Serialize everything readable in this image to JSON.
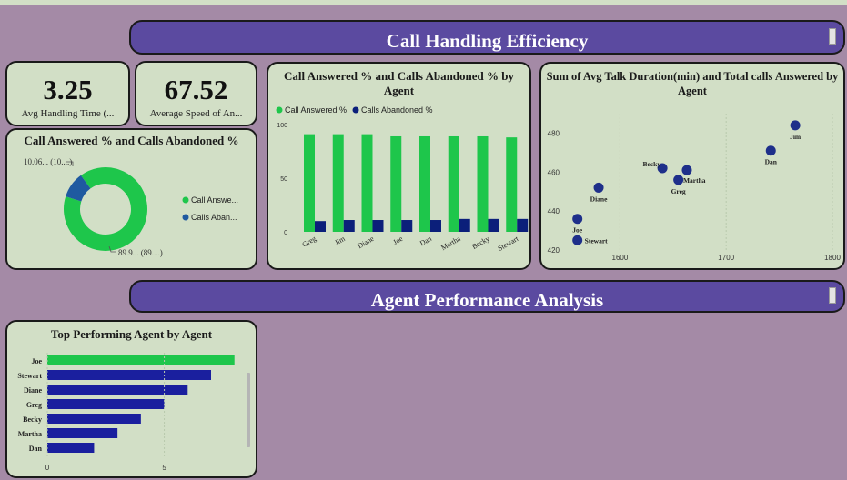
{
  "colors": {
    "green": "#1ec64b",
    "navy": "#0b1f7a",
    "blue": "#1a1f9e",
    "teal": "#1f5aa0",
    "banner": "#5b4aa0",
    "card": "#d2dfc6"
  },
  "banner1": {
    "title": "Call Handling Efficiency"
  },
  "banner2": {
    "title": "Agent Performance Analysis"
  },
  "kpi1": {
    "value": "3.25",
    "label": "Avg Handling Time (..."
  },
  "kpi2": {
    "value": "67.52",
    "label": "Average Speed of An..."
  },
  "donut": {
    "title": "Call Answered % and Calls Abandoned %",
    "label_top": "10.06... (10....)",
    "label_bottom": "89.9... (89....)",
    "legend": [
      "Call Answe...",
      "Calls Aban..."
    ]
  },
  "bar_chart": {
    "title": "Call Answered % and Calls Abandoned % by Agent",
    "legend": [
      "Call Answered %",
      "Calls Abandoned %"
    ]
  },
  "scatter_chart": {
    "title": "Sum of Avg Talk Duration(min) and Total calls Answered by Agent"
  },
  "hbar_chart": {
    "title": "Top Performing Agent by Agent"
  },
  "chart_data": [
    {
      "type": "pie",
      "labels": [
        "Call Answe...",
        "Calls Aban..."
      ],
      "values": [
        89.94,
        10.06
      ]
    },
    {
      "type": "bar",
      "categories": [
        "Greg",
        "Jim",
        "Diane",
        "Joe",
        "Dan",
        "Martha",
        "Becky",
        "Stewart"
      ],
      "series": [
        {
          "name": "Call Answered %",
          "values": [
            91,
            91,
            91,
            89,
            89,
            89,
            89,
            88
          ]
        },
        {
          "name": "Calls Abandoned %",
          "values": [
            10,
            11,
            11,
            11,
            11,
            12,
            12,
            12
          ]
        }
      ],
      "yticks": [
        "0",
        "50",
        "100"
      ],
      "ylim": [
        0,
        100
      ]
    },
    {
      "type": "scatter",
      "points": [
        {
          "label": "Jim",
          "x": 1765,
          "y": 484
        },
        {
          "label": "Dan",
          "x": 1742,
          "y": 471
        },
        {
          "label": "Becky",
          "x": 1640,
          "y": 462
        },
        {
          "label": "Martha",
          "x": 1663,
          "y": 461
        },
        {
          "label": "Greg",
          "x": 1655,
          "y": 456
        },
        {
          "label": "Diane",
          "x": 1580,
          "y": 452
        },
        {
          "label": "Joe",
          "x": 1560,
          "y": 436
        },
        {
          "label": "Stewart",
          "x": 1560,
          "y": 425
        }
      ],
      "xticks": [
        "1600",
        "1700",
        "1800"
      ],
      "yticks": [
        "420",
        "440",
        "460",
        "480"
      ],
      "xlim": [
        1550,
        1800
      ],
      "ylim": [
        420,
        490
      ]
    },
    {
      "type": "bar",
      "orientation": "horizontal",
      "categories": [
        "Joe",
        "Stewart",
        "Diane",
        "Greg",
        "Becky",
        "Martha",
        "Dan"
      ],
      "values": [
        8,
        7,
        6,
        5,
        4,
        3,
        2
      ],
      "xticks": [
        "0",
        "5"
      ],
      "xlim": [
        0,
        8.4
      ]
    }
  ]
}
